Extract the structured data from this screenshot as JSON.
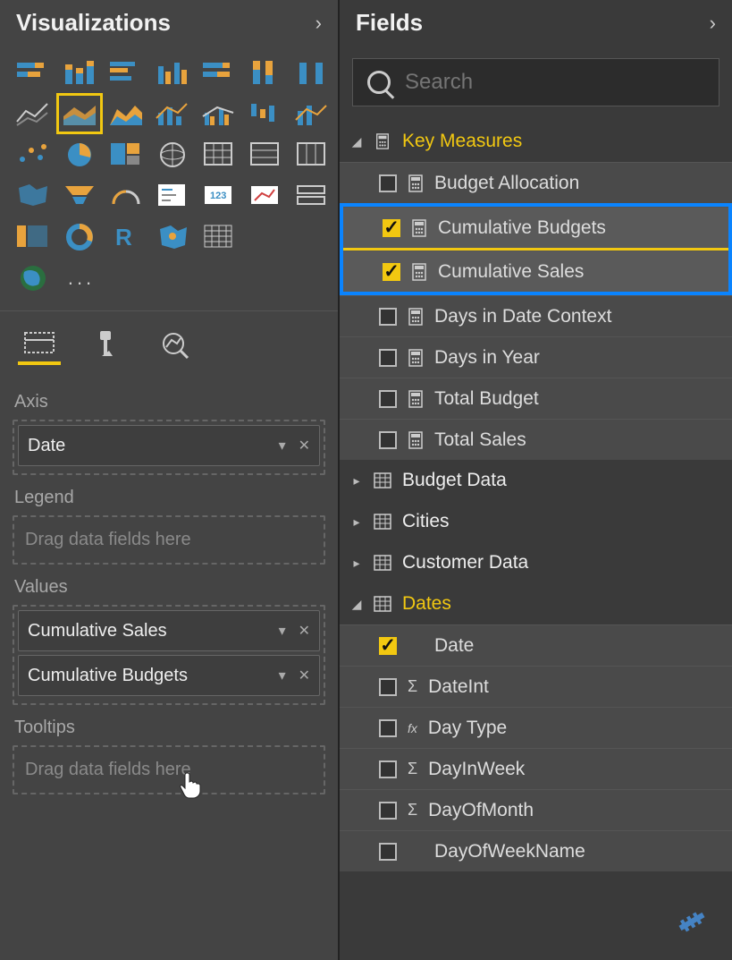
{
  "viz": {
    "title": "Visualizations",
    "more": "...",
    "tabs": {
      "fields": "fields",
      "format": "format",
      "analytics": "analytics"
    },
    "wells": {
      "axis": {
        "label": "Axis",
        "items": [
          "Date"
        ]
      },
      "legend": {
        "label": "Legend",
        "placeholder": "Drag data fields here"
      },
      "values": {
        "label": "Values",
        "items": [
          "Cumulative Sales",
          "Cumulative Budgets"
        ]
      },
      "tooltips": {
        "label": "Tooltips",
        "placeholder": "Drag data fields here"
      }
    }
  },
  "fields": {
    "title": "Fields",
    "search_placeholder": "Search",
    "tables": [
      {
        "name": "Key Measures",
        "expanded": true,
        "active": true,
        "icon": "measure-table",
        "fields": [
          {
            "name": "Budget Allocation",
            "checked": false,
            "type": "measure"
          },
          {
            "name": "Cumulative Budgets",
            "checked": true,
            "type": "measure",
            "highlighted": true
          },
          {
            "name": "Cumulative Sales",
            "checked": true,
            "type": "measure",
            "highlighted": true
          },
          {
            "name": "Days in Date Context",
            "checked": false,
            "type": "measure"
          },
          {
            "name": "Days in Year",
            "checked": false,
            "type": "measure"
          },
          {
            "name": "Total Budget",
            "checked": false,
            "type": "measure"
          },
          {
            "name": "Total Sales",
            "checked": false,
            "type": "measure"
          }
        ]
      },
      {
        "name": "Budget Data",
        "expanded": false,
        "icon": "table"
      },
      {
        "name": "Cities",
        "expanded": false,
        "icon": "table"
      },
      {
        "name": "Customer Data",
        "expanded": false,
        "icon": "table"
      },
      {
        "name": "Dates",
        "expanded": true,
        "active": true,
        "icon": "table",
        "fields": [
          {
            "name": "Date",
            "checked": true,
            "type": "column"
          },
          {
            "name": "DateInt",
            "checked": false,
            "type": "sum"
          },
          {
            "name": "Day Type",
            "checked": false,
            "type": "fx"
          },
          {
            "name": "DayInWeek",
            "checked": false,
            "type": "sum"
          },
          {
            "name": "DayOfMonth",
            "checked": false,
            "type": "sum"
          },
          {
            "name": "DayOfWeekName",
            "checked": false,
            "type": "column"
          }
        ]
      }
    ]
  }
}
